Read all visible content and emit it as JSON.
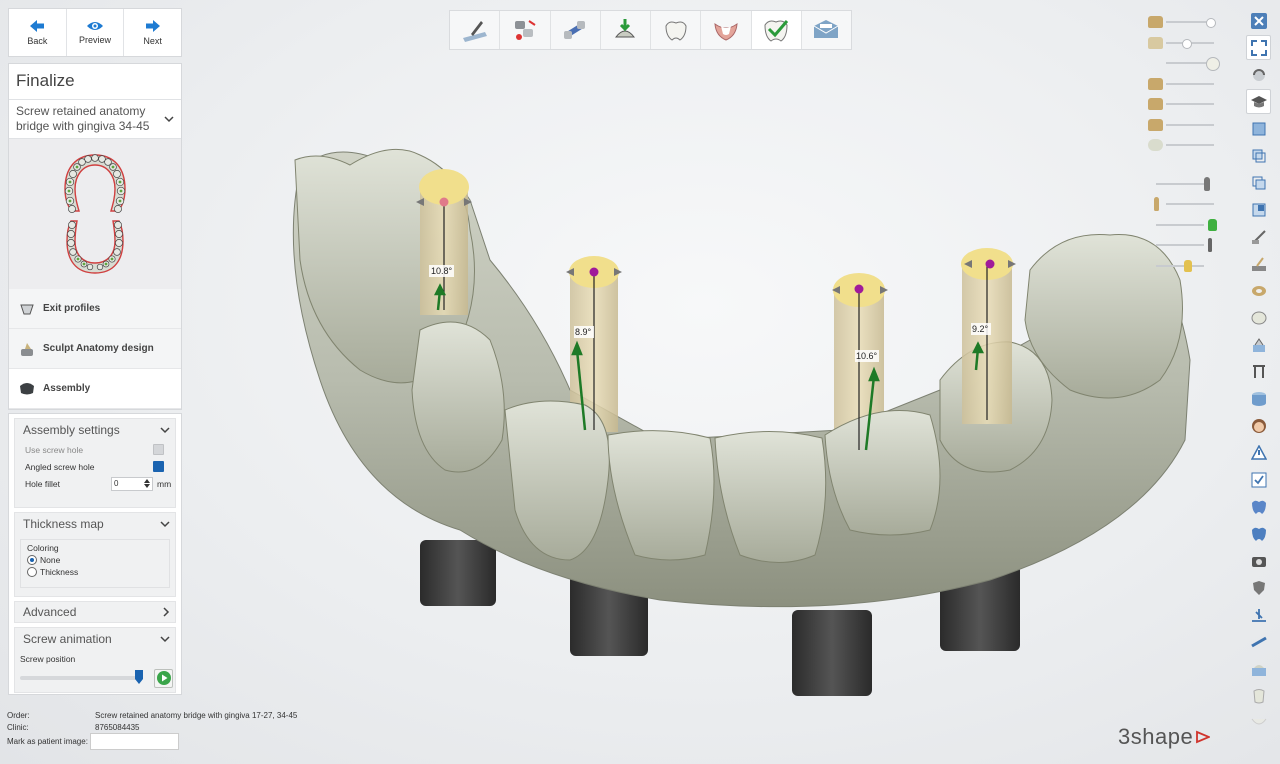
{
  "nav": {
    "back": "Back",
    "preview": "Preview",
    "next": "Next"
  },
  "panel": {
    "title": "Finalize",
    "design_select": "Screw retained anatomy bridge with gingiva 34-45",
    "steps": [
      {
        "label": "Exit profiles"
      },
      {
        "label": "Sculpt Anatomy design"
      },
      {
        "label": "Assembly"
      }
    ]
  },
  "assembly": {
    "header": "Assembly settings",
    "use_screw_hole": "Use screw hole",
    "angled_screw_hole": "Angled screw hole",
    "hole_fillet": "Hole fillet",
    "hole_fillet_value": "0",
    "hole_fillet_unit": "mm"
  },
  "thickness": {
    "header": "Thickness map",
    "coloring": "Coloring",
    "none": "None",
    "thickness": "Thickness"
  },
  "advanced": {
    "header": "Advanced"
  },
  "screw_animation": {
    "header": "Screw animation",
    "screw_position": "Screw position"
  },
  "viewport": {
    "angles": [
      "10.8°",
      "8.9°",
      "10.6°",
      "9.2°"
    ]
  },
  "info": {
    "order_label": "Order:",
    "order_value": "Screw retained anatomy bridge with gingiva 17-27, 34-45",
    "clinic_label": "Clinic:",
    "clinic_value": "8765084435",
    "patient_image_label": "Mark as patient image:"
  },
  "brand": {
    "logo": "3shape"
  },
  "colors": {
    "accent": "#1a63b0",
    "screw_channel": "#f1df8c",
    "model": "#c7cbbd"
  }
}
